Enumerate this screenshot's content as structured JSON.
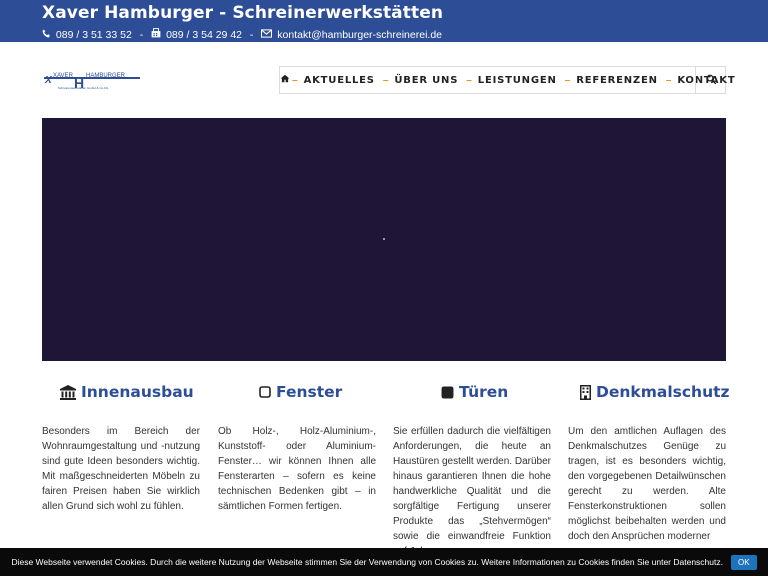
{
  "topbar": {
    "title": "Xaver Hamburger - Schreinerwerkstätten",
    "phone": "089 / 3 51 33 52",
    "fax": "089 / 3 54 29 42",
    "email": "kontakt@hamburger-schreinerei.de",
    "separator": "-"
  },
  "logo": {
    "wordmark_left": "XAVER",
    "wordmark_right": "HAMBURGER",
    "tagline": "Schreinerwerkstätten GmbH & Co.KG"
  },
  "nav": {
    "items": [
      {
        "label": "AKTUELLES"
      },
      {
        "label": "ÜBER UNS"
      },
      {
        "label": "LEISTUNGEN"
      },
      {
        "label": "REFERENZEN"
      },
      {
        "label": "KONTAKT"
      }
    ],
    "dash": "–"
  },
  "features": [
    {
      "icon": "building-icon",
      "title": "Innenausbau",
      "text": "Besonders im Bereich der Wohnraumgestaltung und -nutzung sind gute Ideen besonders wichtig. Mit maßgeschneiderten Möbeln zu fairen Preisen haben Sie wirklich allen Grund sich wohl zu fühlen."
    },
    {
      "icon": "square-outline-icon",
      "title": "Fenster",
      "text": "Ob Holz-, Holz-Aluminium-, Kunststoff- oder Aluminium-Fenster… wir können Ihnen alle Fensterarten – sofern es keine technischen Bedenken gibt – in sämtlichen Formen fertigen."
    },
    {
      "icon": "square-filled-icon",
      "title": "Türen",
      "text": "Sie erfüllen dadurch die vielfältigen Anforderungen, die heute an Haustüren gestellt werden. Darüber hinaus garantieren Ihnen die hohe handwerkliche Qualität und die sorgfältige Fertigung unserer Produkte das „Stehvermögen“ sowie die einwandfreie Funktion auf Jahre"
    },
    {
      "icon": "office-building-icon",
      "title": "Denkmalschutz",
      "text": "Um den amtlichen Auflagen des Denkmalschutzes Genüge zu tragen, ist es besonders wichtig, den vorgegebenen Detailwünschen gerecht zu werden. Alte Fensterkonstruktionen sollen möglichst beibehalten werden und doch den Ansprüchen moderner"
    }
  ],
  "cookie": {
    "text": "Diese Webseite verwendet Cookies. Durch die weitere Nutzung der Webseite stimmen Sie der Verwendung von Cookies zu. Weitere Informationen zu Cookies finden Sie unter Datenschutz.",
    "ok_label": "OK"
  },
  "colors": {
    "brand_blue": "#2d4e96",
    "nav_dash": "#e39a1a",
    "hero_bg": "#1f1637",
    "cookie_bg": "#0a0a0a",
    "ok_button": "#1e73be"
  }
}
